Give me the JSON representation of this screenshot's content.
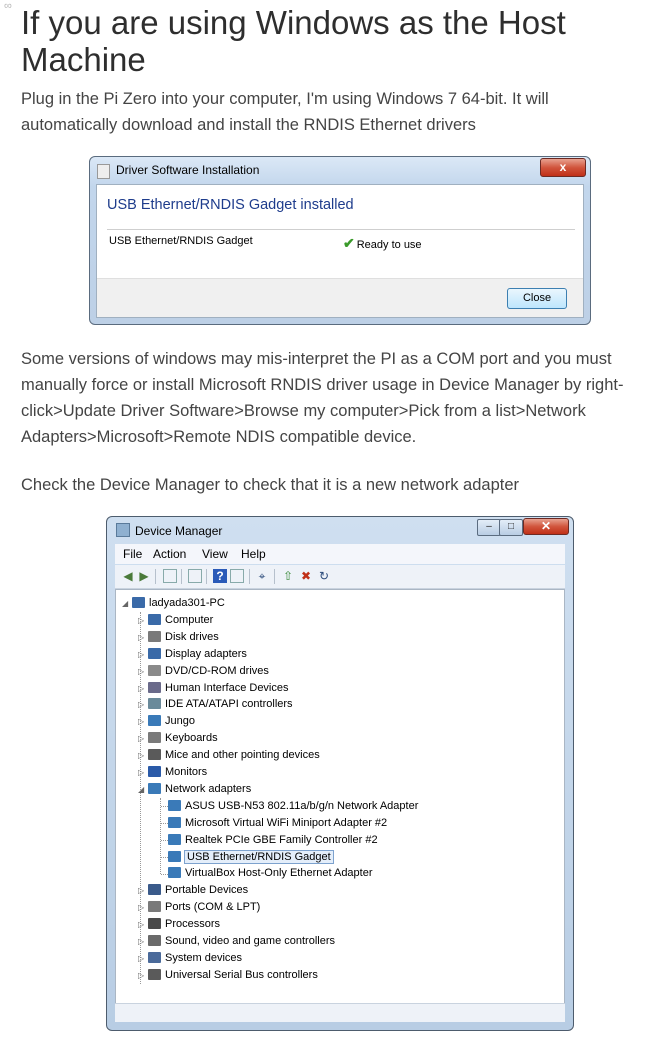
{
  "page": {
    "heading": "If you are using Windows as the Host Machine",
    "intro": "Plug in the Pi Zero into your computer, I'm using Windows 7 64-bit. It will automatically download and install the RNDIS Ethernet drivers",
    "para2": "Some versions of windows may mis-interpret the PI as a COM port and you must manually force or install Microsoft RNDIS driver usage in Device Manager by right-click>Update Driver Software>Browse my computer>Pick from a list>Network Adapters>Microsoft>Remote NDIS compatible device.",
    "para3": "Check the Device Manager to check that it is a new network adapter"
  },
  "driver_dialog": {
    "title": "Driver Software Installation",
    "heading": "USB Ethernet/RNDIS Gadget installed",
    "device": "USB Ethernet/RNDIS Gadget",
    "status": "Ready to use",
    "close_label": "Close",
    "close_x": "x"
  },
  "device_manager": {
    "title": "Device Manager",
    "menus": [
      "File",
      "Action",
      "View",
      "Help"
    ],
    "computer": "ladyada301-PC",
    "categories": [
      {
        "label": "Computer",
        "icon": "computer-icon"
      },
      {
        "label": "Disk drives",
        "icon": "disk-icon"
      },
      {
        "label": "Display adapters",
        "icon": "display-icon"
      },
      {
        "label": "DVD/CD-ROM drives",
        "icon": "dvd-icon"
      },
      {
        "label": "Human Interface Devices",
        "icon": "hid-icon"
      },
      {
        "label": "IDE ATA/ATAPI controllers",
        "icon": "ide-icon"
      },
      {
        "label": "Jungo",
        "icon": "jungo-icon"
      },
      {
        "label": "Keyboards",
        "icon": "keyboard-icon"
      },
      {
        "label": "Mice and other pointing devices",
        "icon": "mouse-icon"
      },
      {
        "label": "Monitors",
        "icon": "monitor-icon"
      },
      {
        "label": "Network adapters",
        "icon": "network-icon",
        "expanded": true
      },
      {
        "label": "Portable Devices",
        "icon": "portable-icon"
      },
      {
        "label": "Ports (COM & LPT)",
        "icon": "port-icon"
      },
      {
        "label": "Processors",
        "icon": "cpu-icon"
      },
      {
        "label": "Sound, video and game controllers",
        "icon": "sound-icon"
      },
      {
        "label": "System devices",
        "icon": "system-icon"
      },
      {
        "label": "Universal Serial Bus controllers",
        "icon": "usb-icon"
      }
    ],
    "network_adapters": [
      "ASUS USB-N53 802.11a/b/g/n Network Adapter",
      "Microsoft Virtual WiFi Miniport Adapter #2",
      "Realtek PCIe GBE Family Controller #2",
      "USB Ethernet/RNDIS Gadget",
      "VirtualBox Host-Only Ethernet Adapter"
    ],
    "selected_adapter": "USB Ethernet/RNDIS Gadget"
  },
  "colors": {
    "link_heading": "#1e3c8c",
    "close_red": "#c03018",
    "check_green": "#3a9a2a"
  }
}
